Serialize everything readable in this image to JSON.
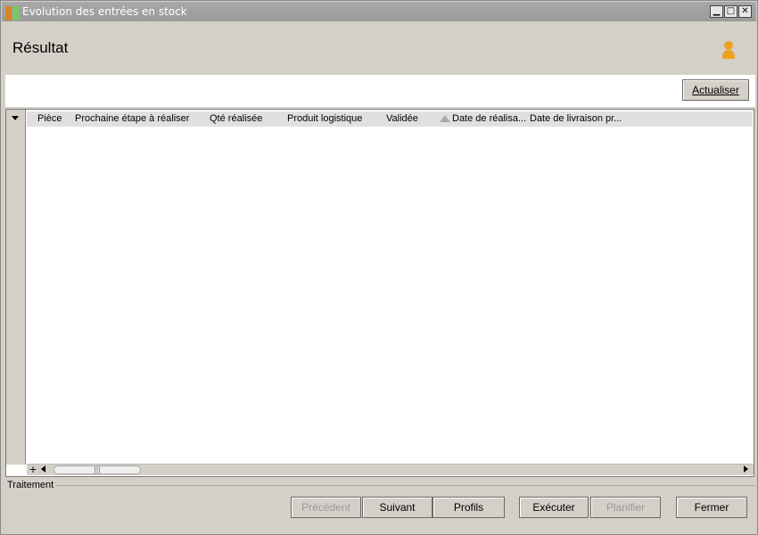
{
  "window": {
    "title": "Evolution des entrées en stock",
    "minimize_glyph": "▁",
    "maximize_glyph": "□",
    "close_glyph": "✕"
  },
  "header": {
    "title": "Résultat",
    "user_icon": "user-icon"
  },
  "toolbar": {
    "refresh_label": "Actualiser"
  },
  "grid": {
    "columns": [
      "Pièce",
      "Prochaine étape à réaliser",
      "Qté réalisée",
      "Produit logistique",
      "Validée",
      "Date de réalisa...",
      "Date de livraison pr..."
    ],
    "sorted_column": "Date de réalisa...",
    "sort_direction": "ascending",
    "rows": [],
    "expand_glyph": "+",
    "scroll_thumb_grip": "|||"
  },
  "footer": {
    "section_label": "Traitement",
    "buttons": {
      "previous": "Précédent",
      "next": "Suivant",
      "profiles": "Profils",
      "execute": "Exécuter",
      "schedule": "Planifier",
      "close": "Fermer"
    },
    "disabled": [
      "Précédent",
      "Planifier"
    ]
  },
  "colors": {
    "title_bar": "#9a9a9a",
    "window_bg": "#d4d0c8",
    "user_icon": "#f0a020",
    "icon_orange": "#d9822b",
    "icon_green": "#7cc466"
  }
}
